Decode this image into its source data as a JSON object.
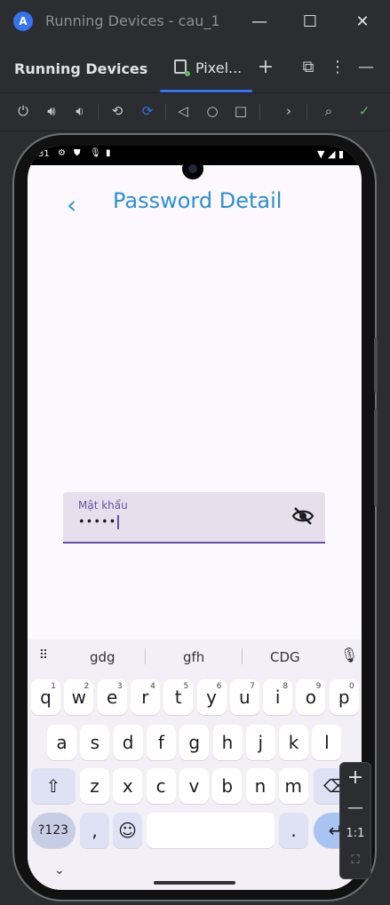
{
  "window": {
    "title": "Running Devices - cau_1"
  },
  "toolwindow": {
    "title": "Running Devices",
    "tab_label": "Pixel..."
  },
  "device": {
    "status_time": "31",
    "page": {
      "title": "Password Detail"
    },
    "password_field": {
      "label": "Mật khẩu",
      "value": "•••••"
    },
    "keyboard": {
      "suggestions": [
        "gdg",
        "gfh",
        "CDG"
      ],
      "row1": [
        {
          "k": "q",
          "n": "1"
        },
        {
          "k": "w",
          "n": "2"
        },
        {
          "k": "e",
          "n": "3"
        },
        {
          "k": "r",
          "n": "4"
        },
        {
          "k": "t",
          "n": "5"
        },
        {
          "k": "y",
          "n": "6"
        },
        {
          "k": "u",
          "n": "7"
        },
        {
          "k": "i",
          "n": "8"
        },
        {
          "k": "o",
          "n": "9"
        },
        {
          "k": "p",
          "n": "0"
        }
      ],
      "row2": [
        "a",
        "s",
        "d",
        "f",
        "g",
        "h",
        "j",
        "k",
        "l"
      ],
      "row3": [
        "z",
        "x",
        "c",
        "v",
        "b",
        "n",
        "m"
      ],
      "symbols_label": "?123",
      "comma": ",",
      "period": "."
    }
  },
  "zoom": {
    "ratio_label": "1:1"
  },
  "colors": {
    "accent": "#2a8fd6",
    "field_accent": "#6750a4",
    "ide_accent": "#3574f0"
  }
}
